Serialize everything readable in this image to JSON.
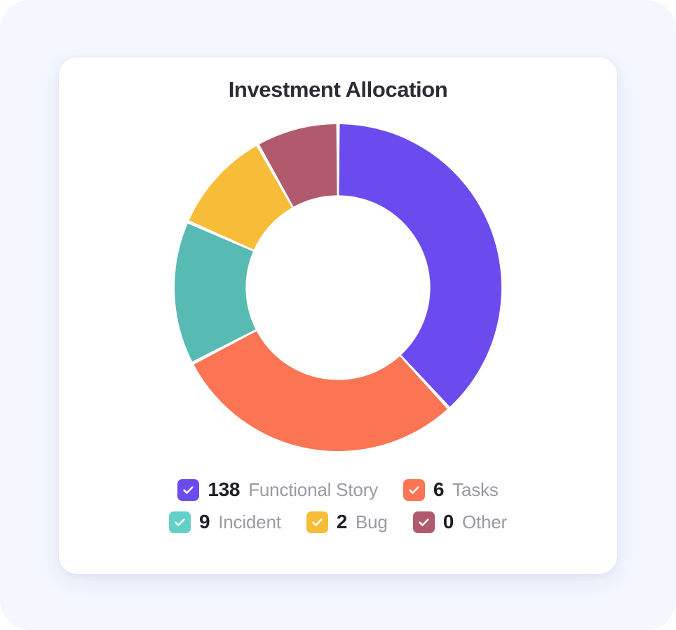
{
  "card": {
    "title": "Investment Allocation"
  },
  "legend": {
    "rows": [
      [
        {
          "count": "138",
          "label": "Functional Story",
          "color": "#6B4BEE",
          "icon": "check-icon"
        },
        {
          "count": "6",
          "label": "Tasks",
          "color": "#FB7555",
          "icon": "check-icon"
        }
      ],
      [
        {
          "count": "9",
          "label": "Incident",
          "color": "#63CFC9",
          "icon": "check-icon"
        },
        {
          "count": "2",
          "label": "Bug",
          "color": "#F7BC38",
          "icon": "check-icon"
        },
        {
          "count": "0",
          "label": "Other",
          "color": "#B15A6D",
          "icon": "check-icon"
        }
      ]
    ]
  },
  "colors": {
    "page_background": "#F4F7FE",
    "card_background": "#FFFFFF",
    "title_text": "#2C2C35",
    "count_text": "#1E1E26",
    "label_text": "#9A9AA4",
    "purple": "#6B4BEE",
    "coral": "#FB7555",
    "teal": "#57BAB3",
    "amber": "#F7BC38",
    "rose": "#B15A6D"
  },
  "chart_data": {
    "type": "pie",
    "variant": "donut",
    "title": "Investment Allocation",
    "xlabel": "",
    "ylabel": "",
    "grid": false,
    "legend_position": "bottom",
    "start_angle_deg": 0,
    "direction": "clockwise",
    "inner_radius_ratio": 0.565,
    "slice_gap_deg": 1.2,
    "categories": [
      "Functional Story",
      "Tasks",
      "Incident",
      "Bug",
      "Other"
    ],
    "values": [
      138,
      6,
      9,
      2,
      0
    ],
    "colors": [
      "#6B4BEE",
      "#FB7555",
      "#57BAB3",
      "#F7BC38",
      "#B15A6D"
    ],
    "rendered_sweep_deg": [
      145,
      111,
      54,
      39,
      31
    ],
    "rendered_percent": [
      40.3,
      30.8,
      15.0,
      10.8,
      8.6
    ],
    "slices": [
      {
        "label": "Functional Story",
        "value": 138,
        "color": "#6B4BEE",
        "sweep_deg": 145,
        "percent": 40.3
      },
      {
        "label": "Tasks",
        "value": 6,
        "color": "#FB7555",
        "sweep_deg": 111,
        "percent": 30.8
      },
      {
        "label": "Incident",
        "value": 9,
        "color": "#57BAB3",
        "sweep_deg": 54,
        "percent": 15.0
      },
      {
        "label": "Bug",
        "value": 2,
        "color": "#F7BC38",
        "sweep_deg": 39,
        "percent": 10.8
      },
      {
        "label": "Other",
        "value": 0,
        "color": "#B15A6D",
        "sweep_deg": 31,
        "percent": 8.6
      }
    ]
  }
}
